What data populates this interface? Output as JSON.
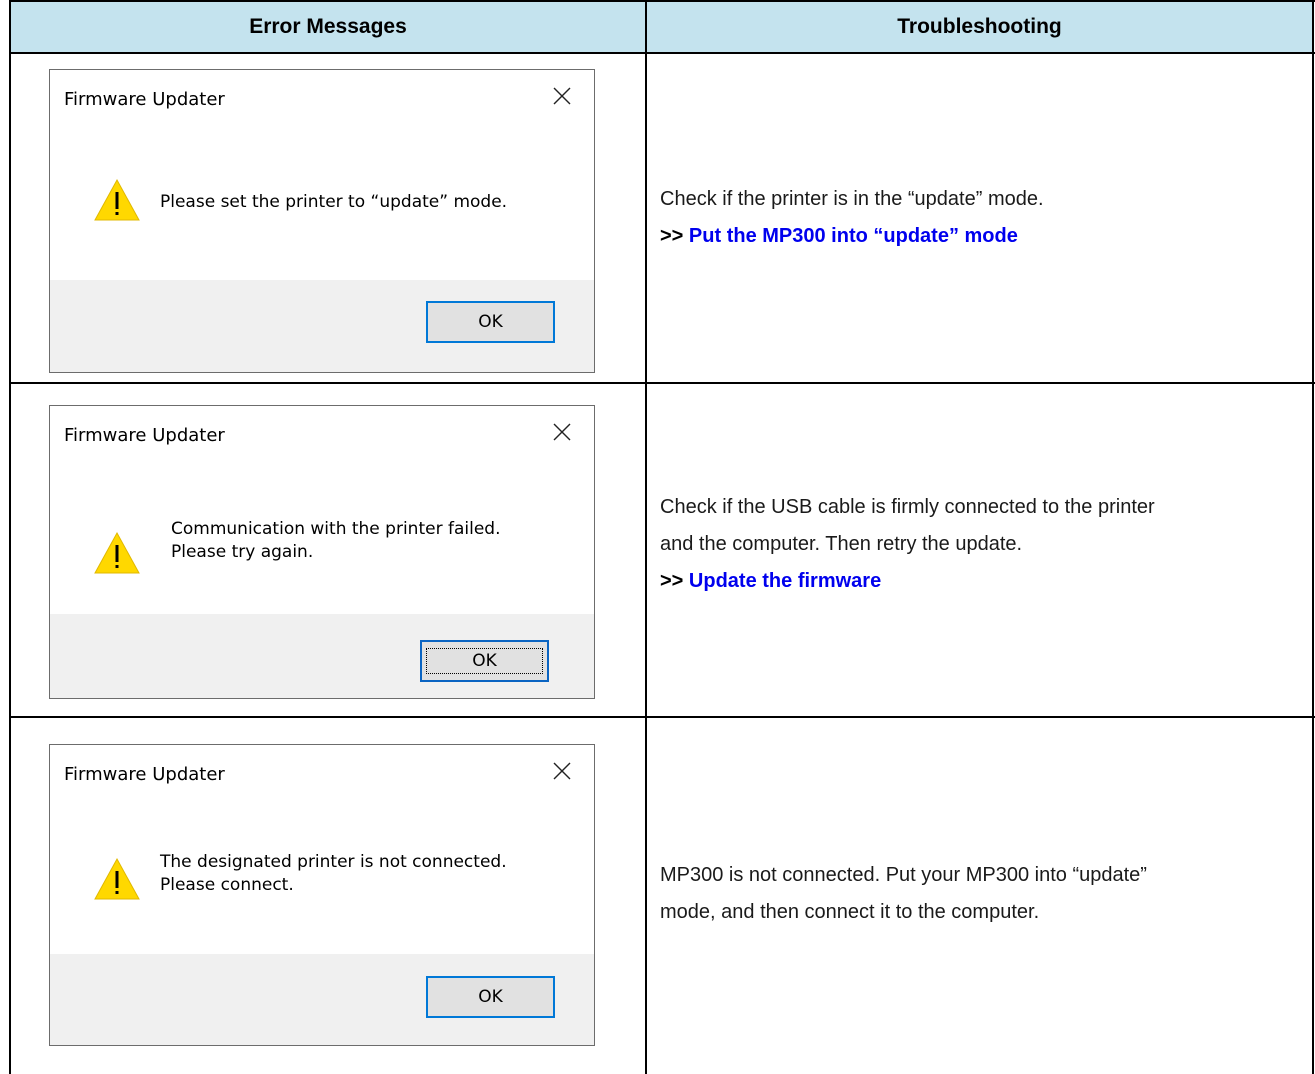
{
  "table": {
    "header_left": "Error Messages",
    "header_right": "Troubleshooting",
    "header_color": "#c4e3ee"
  },
  "rows": [
    {
      "dialog": {
        "title": "Firmware Updater",
        "icon": "warning-icon",
        "message": "Please set the printer to “update” mode.",
        "ok": "OK"
      },
      "trouble_line1": "Check if the printer is in the “update” mode.",
      "arrow": ">>",
      "link": "Put the MP300 into “update” mode"
    },
    {
      "dialog": {
        "title": "Firmware Updater",
        "icon": "warning-icon",
        "message": "Communication with the printer failed.\nPlease try again.",
        "ok": "OK"
      },
      "trouble_line1": "Check if the USB cable is firmly connected to the printer",
      "trouble_line2": "and the computer. Then retry the update.",
      "arrow": ">>",
      "link": "Update the firmware"
    },
    {
      "dialog": {
        "title": "Firmware Updater",
        "icon": "warning-icon",
        "message": "The designated printer is not connected.\nPlease connect.",
        "ok": "OK"
      },
      "trouble_line1": "MP300 is not connected. Put your MP300 into “update”",
      "trouble_line2": "mode, and then connect it to the computer."
    }
  ],
  "colors": {
    "link": "#0000ee",
    "warning_fill": "#ffd800",
    "button_border": "#0078d7"
  }
}
